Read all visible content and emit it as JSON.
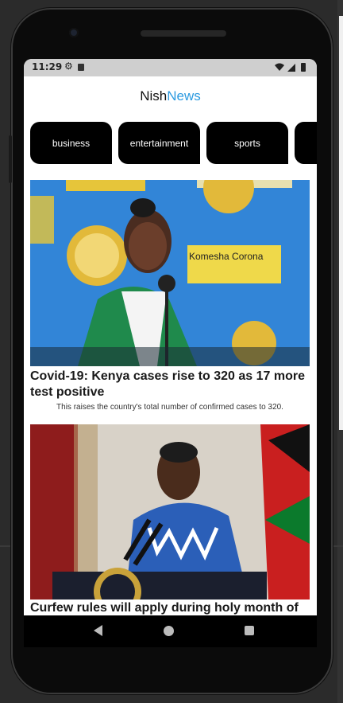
{
  "statusbar": {
    "time": "11:29"
  },
  "app": {
    "brand_part1": "Nish",
    "brand_part2": "News"
  },
  "tabs": [
    "business",
    "entertainment",
    "sports",
    ""
  ],
  "articles": [
    {
      "title": "Covid-19: Kenya cases rise to 320 as 17 more test positive",
      "description": "This raises the country's total number of confirmed cases to 320.",
      "image_sign": "Komesha Corona"
    },
    {
      "title": "Curfew rules will apply during holy month of Ramadhan, says Uhuru",
      "description": ""
    }
  ],
  "colors": {
    "brand_accent": "#2b9ae0",
    "tab_bg": "#000000"
  }
}
